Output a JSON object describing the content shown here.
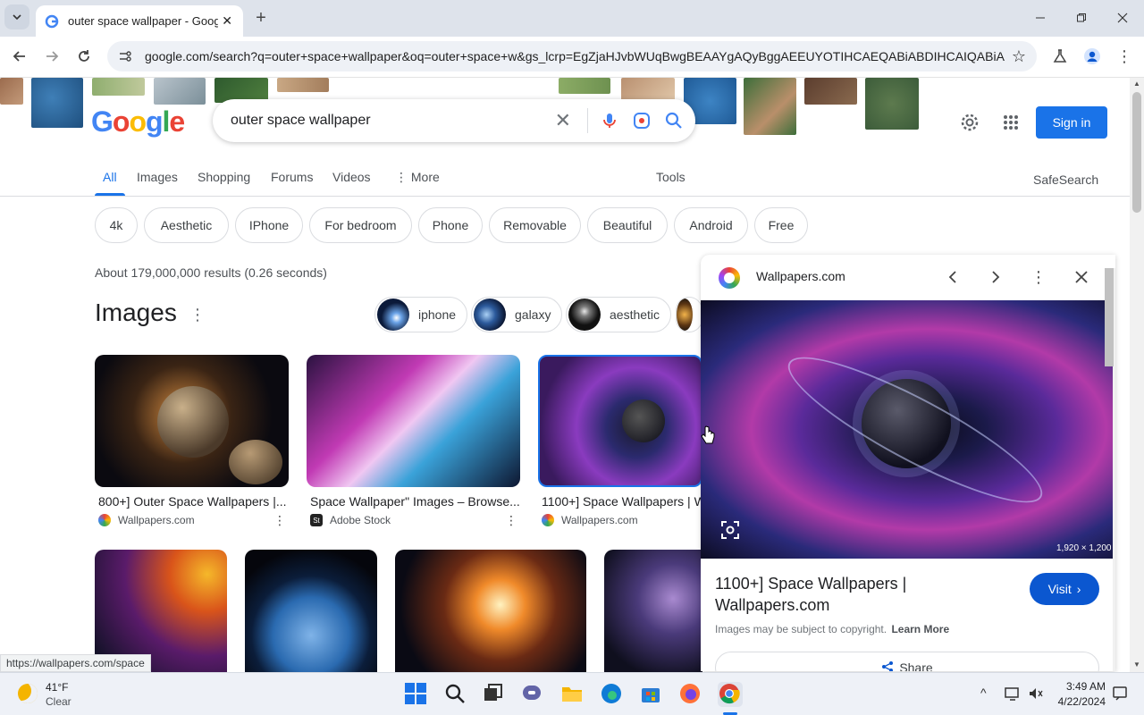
{
  "browser": {
    "tab_title": "outer space wallpaper - Googl",
    "url": "google.com/search?q=outer+space+wallpaper&oq=outer+space+w&gs_lcrp=EgZjaHJvbWUqBwgBEAAYgAQyBggAEEUYOTIHCAEQABiABDIHCAIQABiABD..."
  },
  "google": {
    "logo": "Google",
    "query": "outer space wallpaper",
    "sign_in": "Sign in",
    "nav": [
      "All",
      "Images",
      "Shopping",
      "Forums",
      "Videos",
      "More"
    ],
    "tools": "Tools",
    "safesearch": "SafeSearch",
    "chips": [
      "4k",
      "Aesthetic",
      "IPhone",
      "For bedroom",
      "Phone",
      "Removable",
      "Beautiful",
      "Android",
      "Free"
    ],
    "result_stats": "About 179,000,000 results (0.26 seconds)",
    "images_heading": "Images",
    "pills": [
      "iphone",
      "galaxy",
      "aesthetic"
    ],
    "results": [
      {
        "caption": "800+] Outer Space Wallpapers |...",
        "source": "Wallpapers.com"
      },
      {
        "caption": "Space Wallpaper\" Images – Browse...",
        "source": "Adobe Stock"
      },
      {
        "caption": "1100+] Space Wallpapers | W",
        "source": "Wallpapers.com"
      }
    ]
  },
  "panel": {
    "site": "Wallpapers.com",
    "dimensions": "1,920 × 1,200",
    "title": "1100+] Space Wallpapers | Wallpapers.com",
    "visit": "Visit",
    "copyright": "Images may be subject to copyright.",
    "learn_more": "Learn More",
    "share": "Share"
  },
  "status_url": "https://wallpapers.com/space",
  "taskbar": {
    "temp": "41°F",
    "weather": "Clear",
    "time": "3:49 AM",
    "date": "4/22/2024"
  },
  "colors": {
    "accent": "#1a73e8",
    "tabstrip": "#dee3eb"
  }
}
